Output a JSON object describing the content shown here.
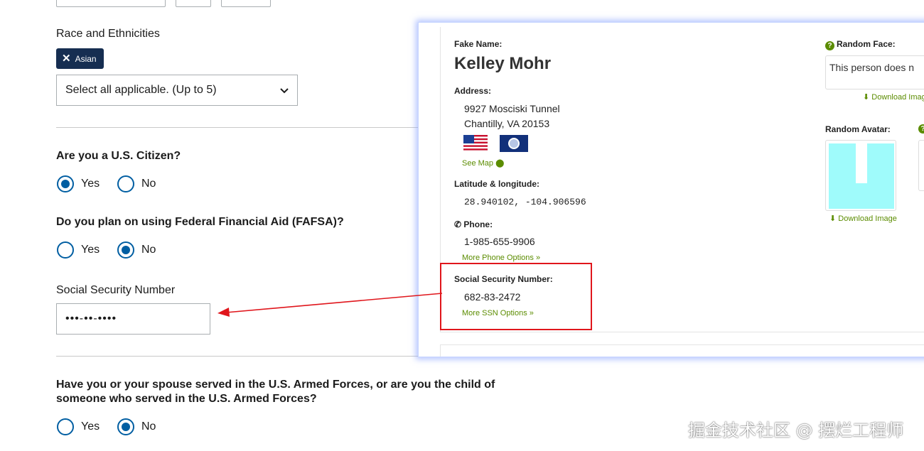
{
  "form": {
    "race_label": "Race and Ethnicities",
    "chip_label": "Asian",
    "select_value": "Select all applicable. (Up to 5)",
    "citizen_question": "Are you a U.S. Citizen?",
    "fafsa_question": "Do you plan on using Federal Financial Aid (FAFSA)?",
    "ssn_label": "Social Security Number",
    "ssn_value": "•••-••-••••",
    "armed_question": "Have you or your spouse served in the U.S. Armed Forces, or are you the child of someone who served in the U.S. Armed Forces?",
    "yes_label": "Yes",
    "no_label": "No",
    "citizen_selected": "Yes",
    "fafsa_selected": "No",
    "armed_selected": "No"
  },
  "panel": {
    "fake_name_label": "Fake Name:",
    "fake_name": "Kelley Mohr",
    "address_label": "Address:",
    "address_line1": "9927 Mosciski Tunnel",
    "address_line2": "Chantilly, VA 20153",
    "see_map": "See Map",
    "latlng_label": "Latitude & longitude:",
    "latlng_value": "28.940102, -104.906596",
    "phone_label": "Phone:",
    "phone_value": "1-985-655-9906",
    "more_phone": "More Phone Options »",
    "ssn_label": "Social Security Number:",
    "ssn_value": "682-83-2472",
    "more_ssn": "More SSN Options »",
    "random_face_label": "Random Face:",
    "face_alt": "This person does n",
    "download_image": "Download Image",
    "random_avatar_label": "Random Avatar:"
  },
  "watermark": "掘金技术社区 @ 摆烂工程师",
  "colors": {
    "primary_blue": "#005ea2",
    "chip_bg": "#162e51",
    "link_green": "#5b8c00",
    "highlight_red": "#e0161c"
  }
}
